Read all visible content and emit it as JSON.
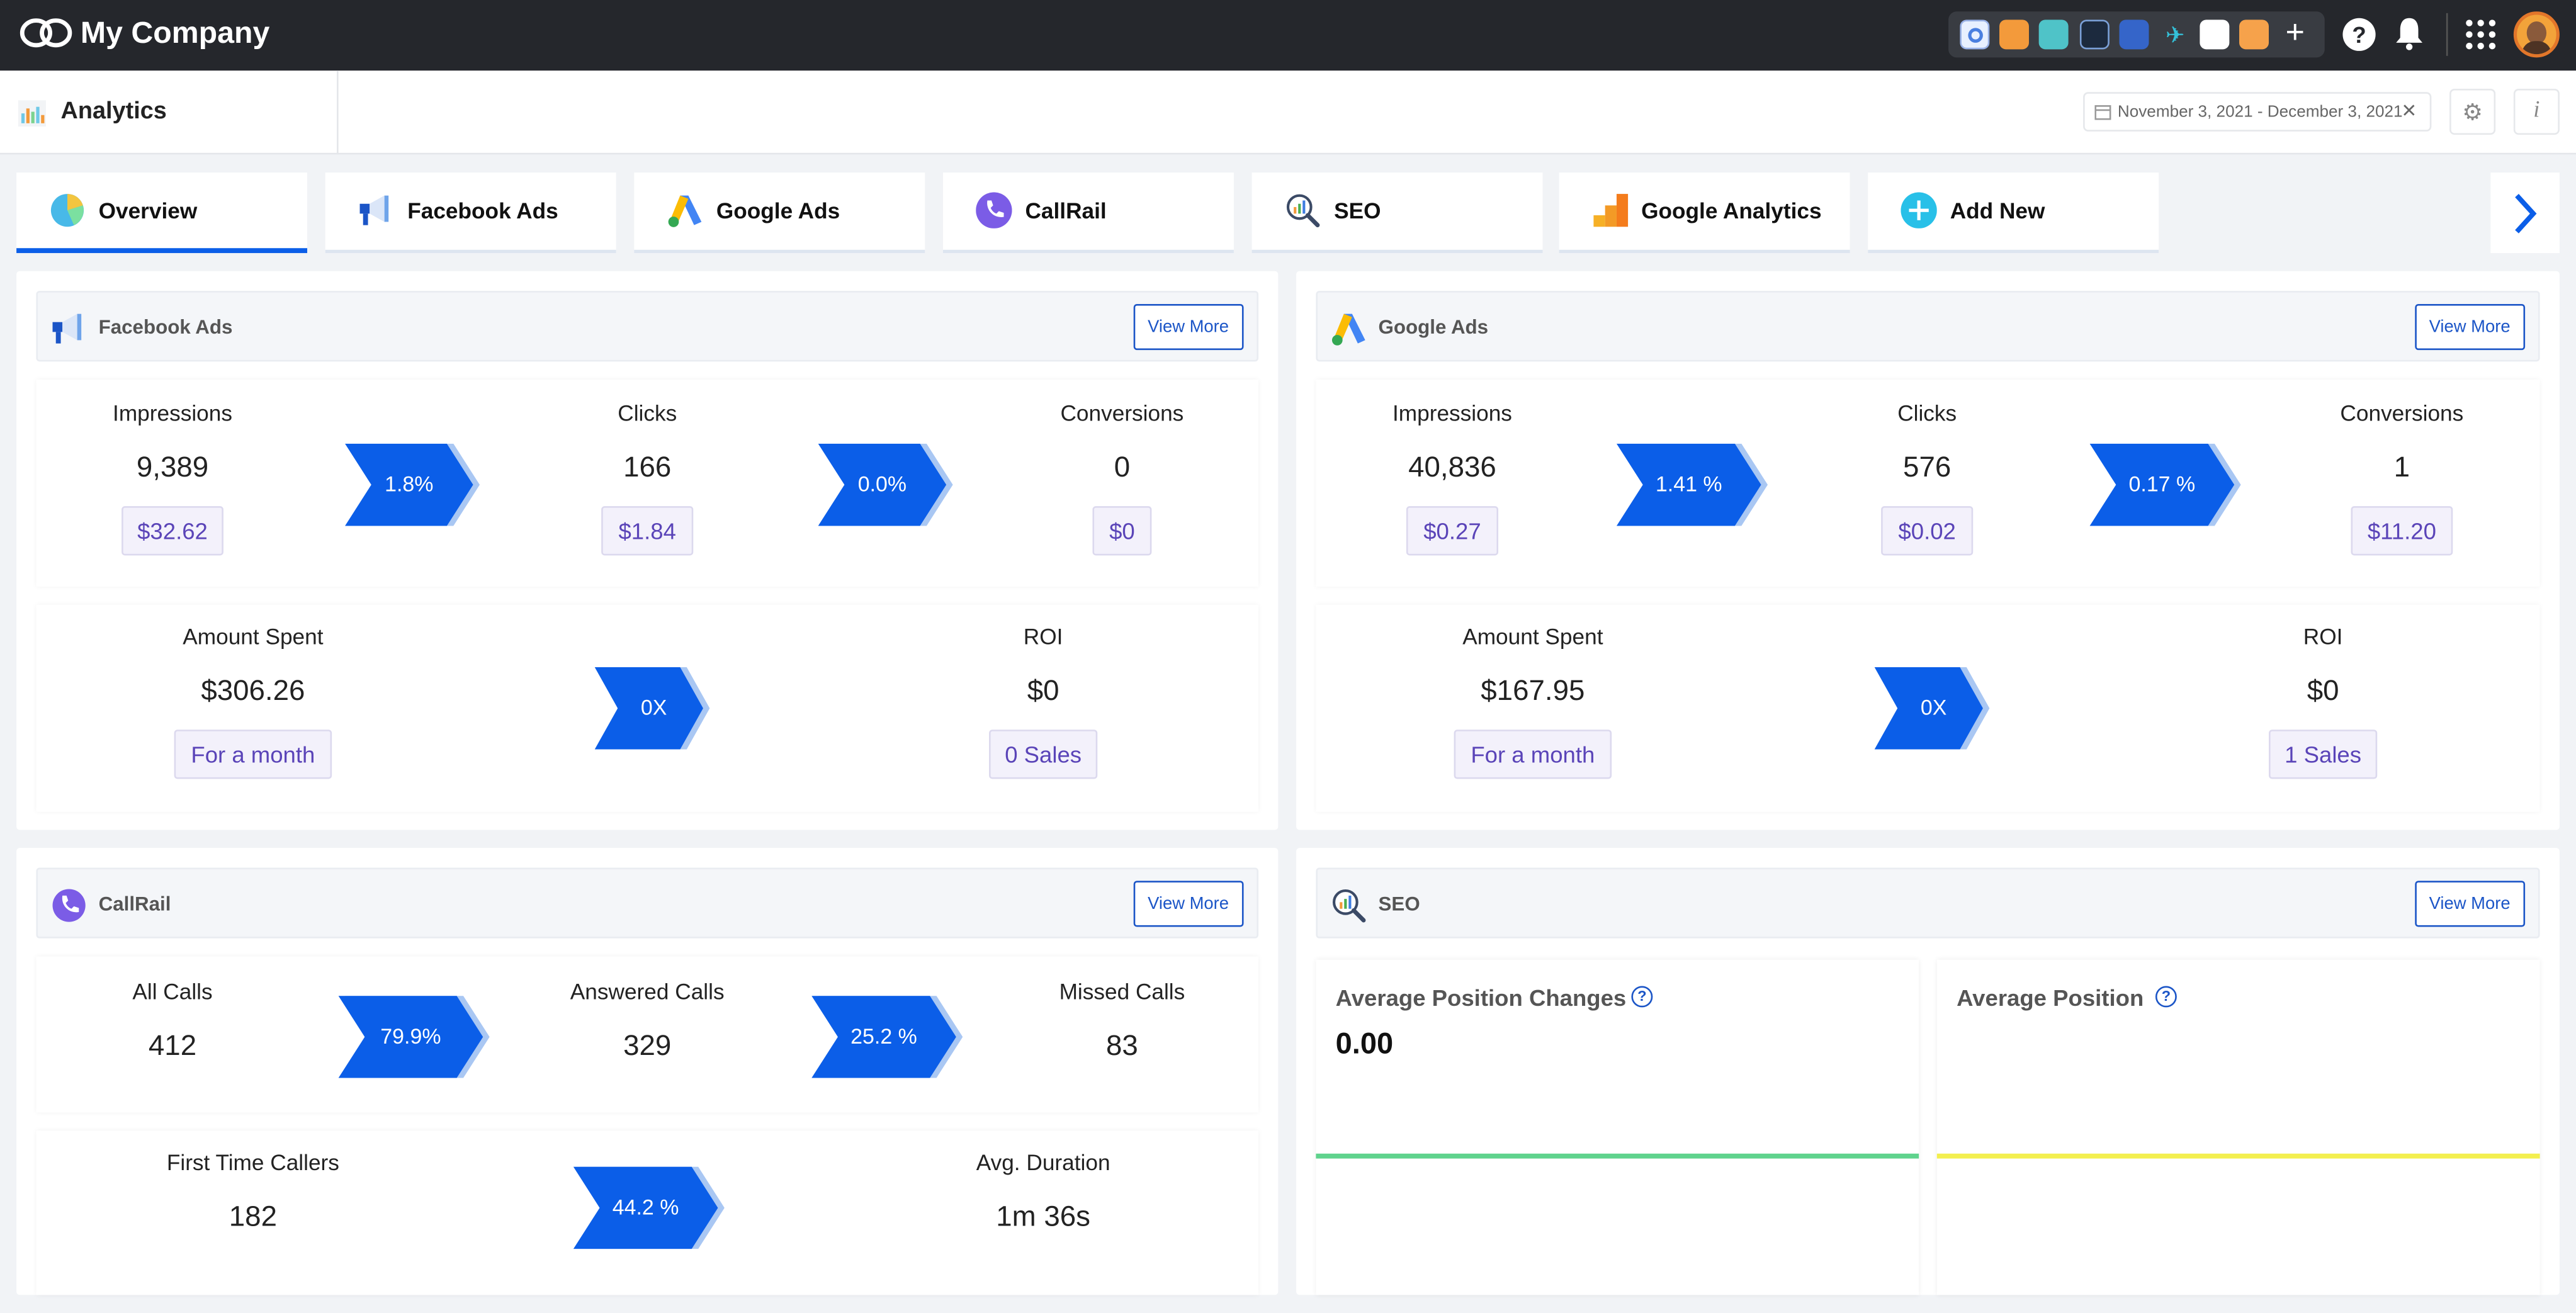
{
  "topbar": {
    "company": "My Company",
    "app_icons": [
      "browser-app-icon",
      "orange-app-icon",
      "calendar-app-icon",
      "screen-app-icon",
      "cube-app-icon",
      "plane-app-icon",
      "analytics-app-icon",
      "notes-app-icon",
      "add-app-icon"
    ],
    "help_icon": "?",
    "bell_icon": "bell"
  },
  "subheader": {
    "title": "Analytics",
    "date_range": "November 3, 2021 - December 3, 2021",
    "clear": "×",
    "settings_icon": "⚙",
    "info_icon": "i"
  },
  "tabs": [
    {
      "label": "Overview",
      "active": true
    },
    {
      "label": "Facebook Ads"
    },
    {
      "label": "Google Ads"
    },
    {
      "label": "CallRail"
    },
    {
      "label": "SEO"
    },
    {
      "label": "Google Analytics"
    },
    {
      "label": "Add New"
    }
  ],
  "view_more": "View More",
  "facebook": {
    "title": "Facebook Ads",
    "impressions": {
      "label": "Impressions",
      "value": "9,389",
      "cost": "$32.62"
    },
    "clicks": {
      "label": "Clicks",
      "value": "166",
      "cost": "$1.84"
    },
    "conversions": {
      "label": "Conversions",
      "value": "0",
      "cost": "$0"
    },
    "ctr": "1.8%",
    "conv_rate": "0.0%",
    "amount": {
      "label": "Amount Spent",
      "value": "$306.26",
      "note": "For a month"
    },
    "roi_rate": "0X",
    "roi": {
      "label": "ROI",
      "value": "$0",
      "note": "0 Sales"
    }
  },
  "google": {
    "title": "Google Ads",
    "impressions": {
      "label": "Impressions",
      "value": "40,836",
      "cost": "$0.27"
    },
    "clicks": {
      "label": "Clicks",
      "value": "576",
      "cost": "$0.02"
    },
    "conversions": {
      "label": "Conversions",
      "value": "1",
      "cost": "$11.20"
    },
    "ctr": "1.41 %",
    "conv_rate": "0.17 %",
    "amount": {
      "label": "Amount Spent",
      "value": "$167.95",
      "note": "For a month"
    },
    "roi_rate": "0X",
    "roi": {
      "label": "ROI",
      "value": "$0",
      "note": "1 Sales"
    }
  },
  "callrail": {
    "title": "CallRail",
    "all": {
      "label": "All Calls",
      "value": "412"
    },
    "answered": {
      "label": "Answered Calls",
      "value": "329"
    },
    "missed": {
      "label": "Missed Calls",
      "value": "83"
    },
    "answer_rate": "79.9%",
    "missed_rate": "25.2 %",
    "first": {
      "label": "First Time Callers",
      "value": "182"
    },
    "first_rate": "44.2 %",
    "duration": {
      "label": "Avg. Duration",
      "value": "1m 36s"
    }
  },
  "seo": {
    "title": "SEO",
    "avg_change": {
      "label": "Average Position Changes",
      "value": "0.00",
      "line_color": "#5fd38d"
    },
    "avg_position": {
      "label": "Average Position",
      "line_color": "#f3ef4f"
    },
    "help": "?"
  },
  "colors": {
    "accent": "#0b5ee8",
    "pill_text": "#5a44b8",
    "topbar": "#25272c"
  }
}
